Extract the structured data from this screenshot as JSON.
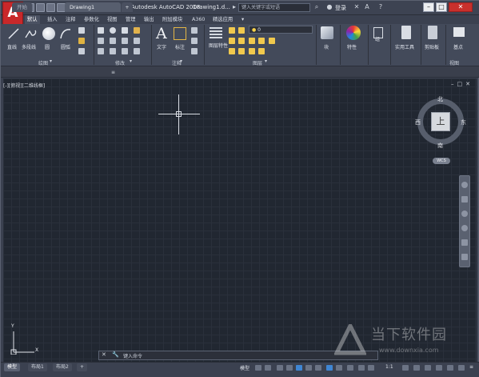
{
  "titlebar": {
    "app_title": "Autodesk AutoCAD 2018",
    "doc_title": "Drawing1.d...",
    "search_placeholder": "键入关键字或短语",
    "user_label": "登录"
  },
  "menu_tabs": [
    "默认",
    "插入",
    "注释",
    "参数化",
    "视图",
    "管理",
    "输出",
    "附加模块",
    "A360",
    "精选应用"
  ],
  "ribbon": {
    "draw_tools": [
      "直线",
      "多段线",
      "圆",
      "圆弧"
    ],
    "text_tools": [
      "文字",
      "标注"
    ],
    "layer_tools": [
      "图层特性"
    ],
    "layer_value": "0",
    "block_label": "块",
    "properties_label": "特性",
    "groups_label": "组",
    "utilities_label": "实用工具",
    "clipboard_label": "剪贴板",
    "view_label": "基点",
    "panels": [
      "绘图",
      "修改",
      "注释",
      "图层",
      "视图"
    ]
  },
  "file_tabs": {
    "start": "开始",
    "drawing": "Drawing1",
    "add": "+"
  },
  "viewport": {
    "label": "[-][俯视][二维线框]",
    "cube_face": "上",
    "north": "北",
    "south": "南",
    "east": "东",
    "west": "西",
    "wcs": "WCS"
  },
  "ucs": {
    "x": "X",
    "y": "Y"
  },
  "command": {
    "placeholder": "键入命令"
  },
  "layouts": [
    "模型",
    "布局1",
    "布局2"
  ],
  "status": {
    "model": "模型",
    "scale": "1:1"
  },
  "watermark": {
    "brand": "当下软件园",
    "url": "www.downxia.com"
  }
}
